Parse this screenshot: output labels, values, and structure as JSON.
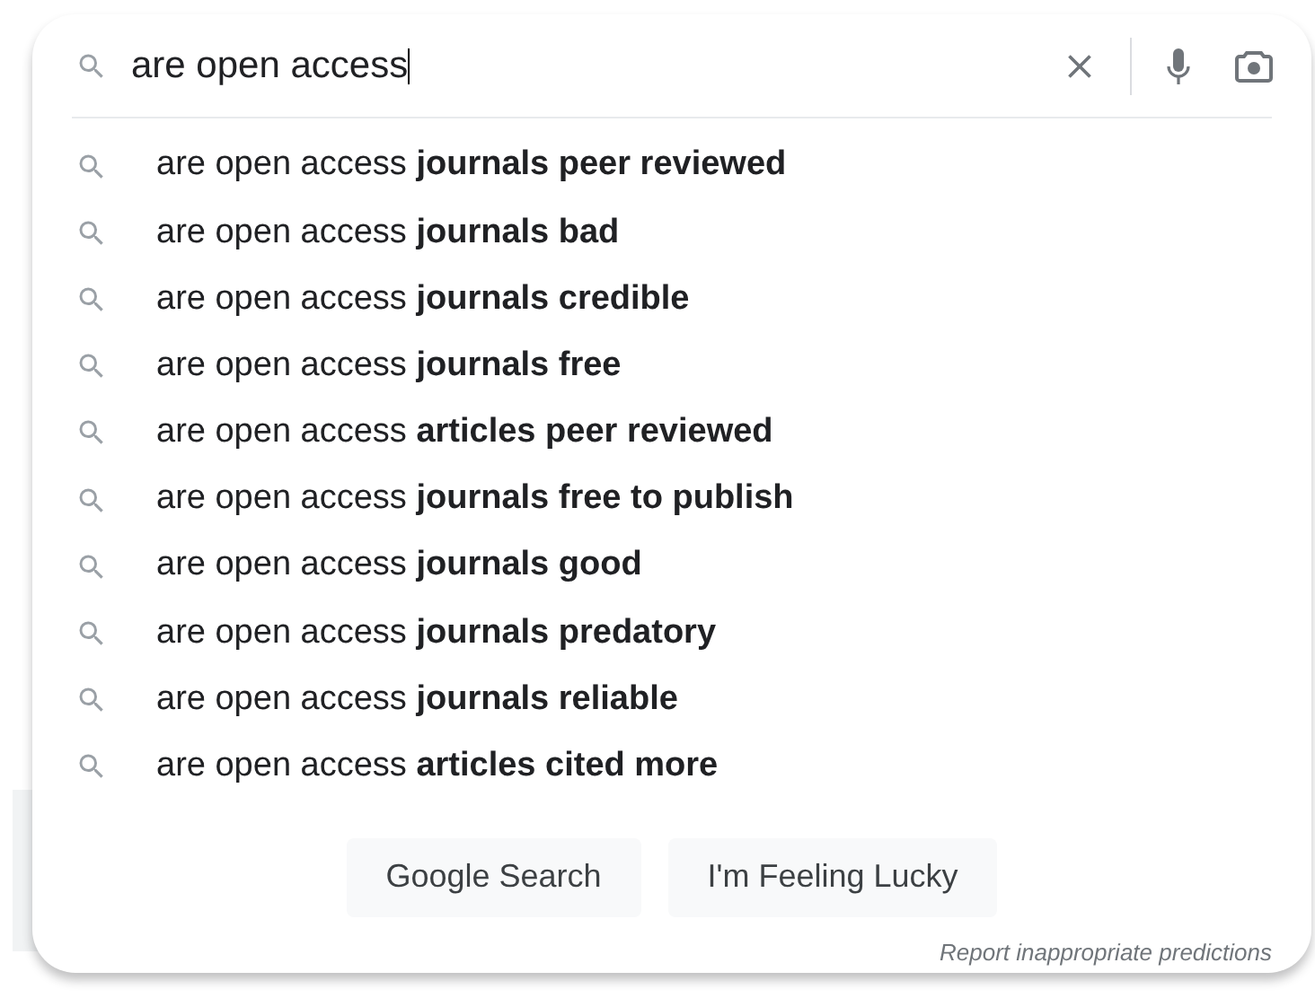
{
  "search": {
    "value": "are open access"
  },
  "suggestions": [
    "are open access **journals peer reviewed**",
    "are open access **journals bad**",
    "are open access **journals credible**",
    "are open access **journals free**",
    "are open access **articles peer reviewed**",
    "are open access **journals free to publish**",
    "are open access **journals good**",
    "are open access **journals predatory**",
    "are open access **journals reliable**",
    "are open access **articles cited more**"
  ],
  "buttons": [
    "Google Search",
    "I'm Feeling Lucky"
  ],
  "report_link": "Report inappropriate predictions"
}
